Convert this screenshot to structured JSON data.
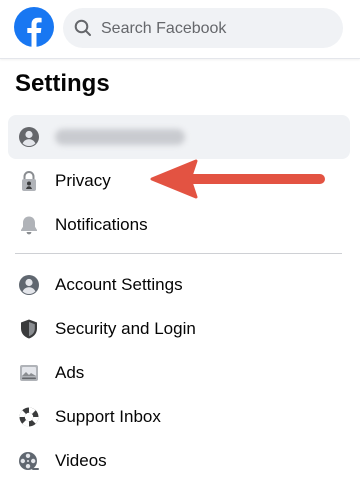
{
  "search": {
    "placeholder": "Search Facebook"
  },
  "page_title": "Settings",
  "menu": {
    "privacy": "Privacy",
    "notifications": "Notifications",
    "account_settings": "Account Settings",
    "security_login": "Security and Login",
    "ads": "Ads",
    "support_inbox": "Support Inbox",
    "videos": "Videos"
  },
  "colors": {
    "brand": "#1877f2",
    "arrow": "#e35342",
    "selected_bg": "#f0f2f5"
  },
  "icons": {
    "logo": "facebook-logo",
    "search": "search-icon",
    "profile": "profile-icon",
    "privacy": "lock-icon",
    "notifications": "bell-icon",
    "account": "person-circle-icon",
    "security": "shield-icon",
    "ads": "ads-icon",
    "support": "lifebuoy-icon",
    "videos": "film-reel-icon"
  }
}
